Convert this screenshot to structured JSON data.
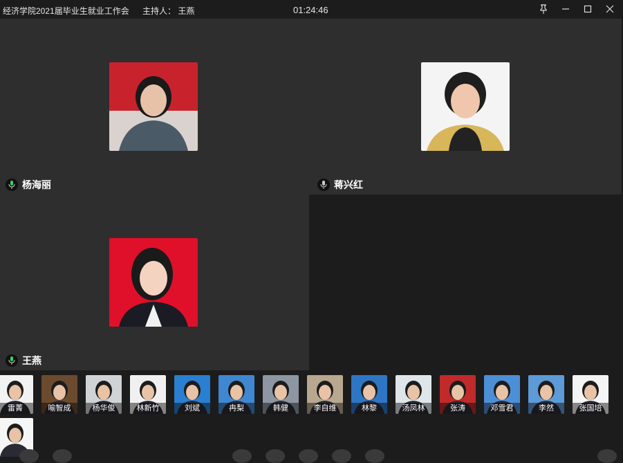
{
  "titlebar": {
    "title": "经济学院2021届毕业生就业工作会",
    "host": "主持人： 王燕",
    "clock": "01:24:46"
  },
  "tiles": [
    {
      "name": "杨海丽",
      "bg": "#c8232c",
      "skin": "#e8c2a8",
      "hair": "#1a1a1a",
      "cloth": "#4a5a66"
    },
    {
      "name": "蒋兴红",
      "bg": "#f4f4f4",
      "skin": "#f0c7ad",
      "hair": "#1e1e1e",
      "cloth": "#222222"
    },
    {
      "name": "王燕",
      "bg": "#e0102a",
      "skin": "#f4d3c0",
      "hair": "#1a1a1a",
      "cloth": "#1b1b24"
    }
  ],
  "participants": [
    {
      "name": "雷菁",
      "bg": "#f2f2f2"
    },
    {
      "name": "喻智成",
      "bg": "#6b4a2e"
    },
    {
      "name": "杨华俊",
      "bg": "#cfd3d6"
    },
    {
      "name": "林新竹",
      "bg": "#f0f0f0"
    },
    {
      "name": "刘斌",
      "bg": "#2a7fd0"
    },
    {
      "name": "冉梨",
      "bg": "#3f87d1"
    },
    {
      "name": "韩健",
      "bg": "#8d97a3"
    },
    {
      "name": "李自维",
      "bg": "#b8a890"
    },
    {
      "name": "林黎",
      "bg": "#2e76c4"
    },
    {
      "name": "汤凤林",
      "bg": "#dfe6ea"
    },
    {
      "name": "张涛",
      "bg": "#c02a2a"
    },
    {
      "name": "邓雪君",
      "bg": "#4d8fd6"
    },
    {
      "name": "李然",
      "bg": "#5d9ad8"
    },
    {
      "name": "张国培",
      "bg": "#f4f4f4"
    },
    {
      "name": "",
      "bg": "#f6f6f6"
    }
  ]
}
